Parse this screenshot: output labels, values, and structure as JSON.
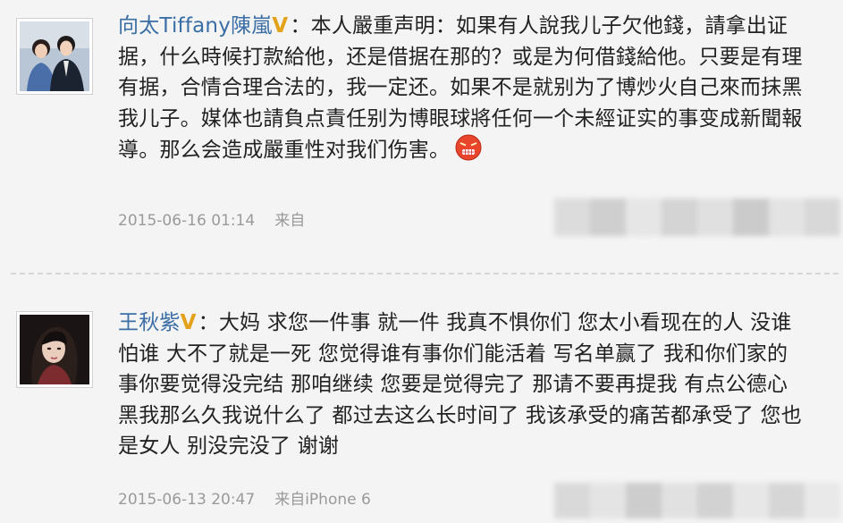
{
  "posts": [
    {
      "username": "向太Tiffany陳嵐",
      "badge": "V",
      "separator": "：",
      "lines": [
        "本人嚴重声明：如果有人說我儿子欠他錢，請拿出证",
        "据，什么時候打款給他，还是借据在那的？或是为何借錢給他。只要是有理",
        "有据，合情合理合法的，我一定还。如果不是就别为了博炒火自己來而抹黑",
        "我儿子。媒体也請負点責任别为博眼球將任何一个未經证实的事变成新聞報",
        "導。那么会造成嚴重性对我们伤害。"
      ],
      "emoji_icon": "angry-face-icon",
      "timestamp": "2015-06-16 01:14",
      "source": "来自"
    },
    {
      "username": "王秋紫",
      "badge": "V",
      "separator": "：",
      "lines": [
        "大妈 求您一件事 就一件 我真不惧你们 您太小看现在的人 没谁",
        "怕谁 大不了就是一死 您觉得谁有事你们能活着 写名单赢了 我和你们家的",
        "事你要觉得没完结 那咱继续 您要是觉得完了 那请不要再提我 有点公德心",
        "黑我那么久我说什么了 都过去这么长时间了 我该承受的痛苦都承受了 您也",
        "是女人 别没完没了 谢谢"
      ],
      "timestamp": "2015-06-13 20:47",
      "source": "来自iPhone 6"
    }
  ],
  "colors": {
    "background": "#f4f4f4",
    "username": "#3a6ea5",
    "badge": "#e3a21a",
    "text": "#222222",
    "meta": "#9a9a9a"
  }
}
